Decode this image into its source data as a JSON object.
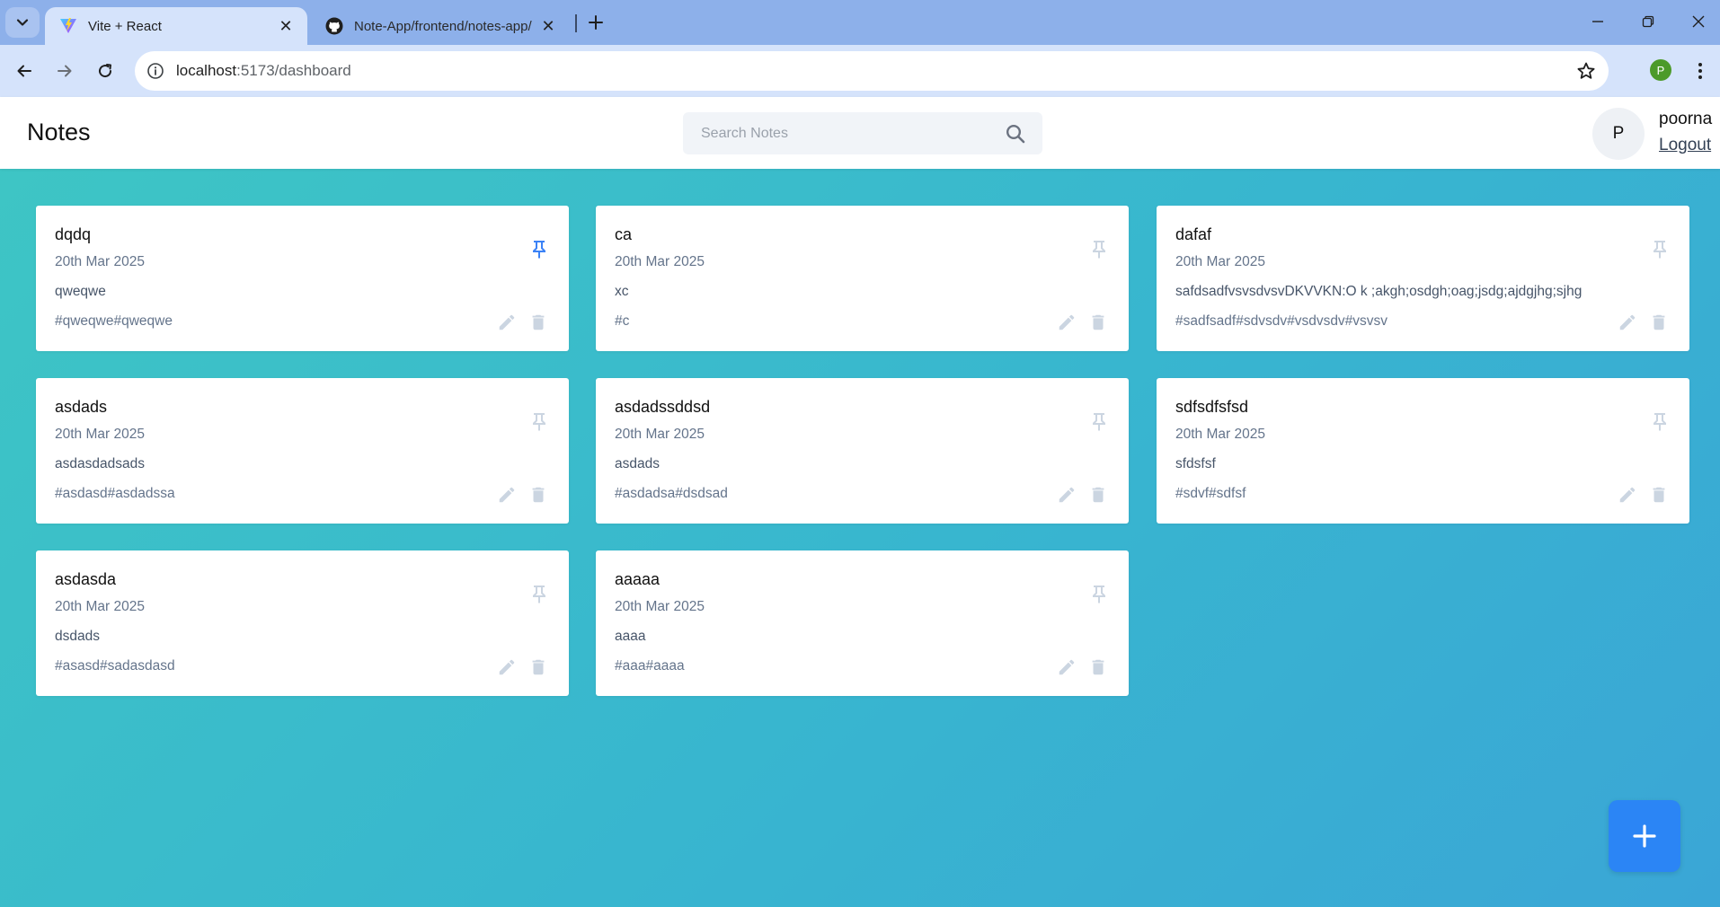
{
  "browser": {
    "tabs": [
      {
        "title": "Vite + React",
        "active": true,
        "favicon": "vite-logo-icon"
      },
      {
        "title": "Note-App/frontend/notes-app/",
        "active": false,
        "favicon": "github-logo-icon"
      }
    ],
    "address": {
      "host": "localhost",
      "path": ":5173/dashboard"
    },
    "profile_initial": "P"
  },
  "app": {
    "brand": "Notes",
    "search": {
      "placeholder": "Search Notes"
    },
    "user": {
      "initial": "P",
      "name": "poorna",
      "logout_label": "Logout"
    },
    "colors": {
      "pin_active": "#3b82f6",
      "icon_muted": "#cbd5e1",
      "fab": "#2b85f5",
      "bg_start": "#3ec6c4",
      "bg_end": "#3aa6d6"
    }
  },
  "notes": [
    {
      "title": "dqdq",
      "date": "20th Mar 2025",
      "content": "qweqwe",
      "tags": "#qweqwe#qweqwe",
      "pinned": true
    },
    {
      "title": "ca",
      "date": "20th Mar 2025",
      "content": "xc",
      "tags": "#c",
      "pinned": false
    },
    {
      "title": "dafaf",
      "date": "20th Mar 2025",
      "content": "safdsadfvsvsdvsvDKVVKN:O k ;akgh;osdgh;oag;jsdg;ajdgjhg;sjhg",
      "tags": "#sadfsadf#sdvsdv#vsdvsdv#vsvsv",
      "pinned": false
    },
    {
      "title": "asdads",
      "date": "20th Mar 2025",
      "content": "asdasdadsads",
      "tags": "#asdasd#asdadssa",
      "pinned": false
    },
    {
      "title": "asdadssddsd",
      "date": "20th Mar 2025",
      "content": "asdads",
      "tags": "#asdadsa#dsdsad",
      "pinned": false
    },
    {
      "title": "sdfsdfsfsd",
      "date": "20th Mar 2025",
      "content": "sfdsfsf",
      "tags": "#sdvf#sdfsf",
      "pinned": false
    },
    {
      "title": "asdasda",
      "date": "20th Mar 2025",
      "content": "dsdads",
      "tags": "#asasd#sadasdasd",
      "pinned": false
    },
    {
      "title": "aaaaa",
      "date": "20th Mar 2025",
      "content": "aaaa",
      "tags": "#aaa#aaaa",
      "pinned": false
    }
  ]
}
